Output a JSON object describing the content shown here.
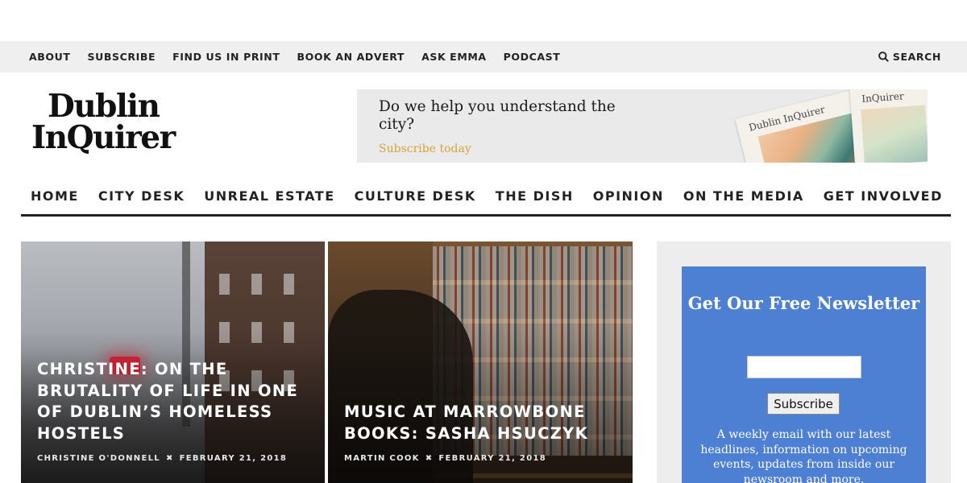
{
  "top_nav": {
    "items": [
      "ABOUT",
      "SUBSCRIBE",
      "FIND US IN PRINT",
      "BOOK AN ADVERT",
      "ASK EMMA",
      "PODCAST"
    ],
    "search_label": "SEARCH"
  },
  "logo": {
    "line1": "Dublin",
    "line2": "InQuirer"
  },
  "banner": {
    "headline": "Do we help you understand the city?",
    "cta": "Subscribe today",
    "paper_title": "Dublin InQuirer",
    "paper_title_2": "InQuirer"
  },
  "main_nav": {
    "items": [
      "HOME",
      "CITY DESK",
      "UNREAL ESTATE",
      "CULTURE DESK",
      "THE DISH",
      "OPINION",
      "ON THE MEDIA",
      "GET INVOLVED"
    ]
  },
  "featured": [
    {
      "title": "CHRISTINE: ON THE BRUTALITY OF LIFE IN ONE OF DUBLIN’S HOMELESS HOSTELS",
      "author": "CHRISTINE O'DONNELL",
      "date": "FEBRUARY 21, 2018"
    },
    {
      "title": "MUSIC AT MARROWBONE BOOKS: SASHA HSUCZYK",
      "author": "MARTIN COOK",
      "date": "FEBRUARY 21, 2018"
    }
  ],
  "meta_separator": "✖",
  "newsletter": {
    "title": "Get Our Free Newsletter",
    "button": "Subscribe",
    "description": "A weekly email with our latest headlines, information on upcoming events, updates from inside our newsroom and more.",
    "input_value": ""
  },
  "colors": {
    "topbar": "#efefef",
    "newsletter_bg": "#4d7fd3",
    "sidebar_bg": "#ededed",
    "cta": "#d9a23a"
  }
}
